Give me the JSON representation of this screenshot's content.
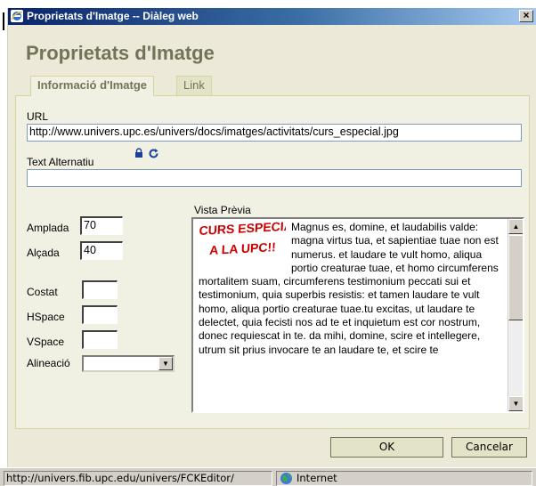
{
  "window": {
    "title": "Proprietats d'Imatge -- Diàleg web",
    "close_glyph": "×"
  },
  "dialog": {
    "heading": "Proprietats d'Imatge"
  },
  "tabs": [
    {
      "label": "Informació d'Imatge",
      "active": true
    },
    {
      "label": "Link",
      "active": false
    }
  ],
  "form": {
    "url_label": "URL",
    "url_value": "http://www.univers.upc.es/univers/docs/imatges/activitats/curs_especial.jpg",
    "alt_label": "Text Alternatiu",
    "alt_value": "",
    "width_label": "Amplada",
    "width_value": "70",
    "height_label": "Alçada",
    "height_value": "40",
    "border_label": "Costat",
    "border_value": "",
    "hspace_label": "HSpace",
    "hspace_value": "",
    "vspace_label": "VSpace",
    "vspace_value": "",
    "align_label": "Alineació",
    "align_value": ""
  },
  "preview": {
    "label": "Vista Prèvia",
    "logo_line1": "CURS ESPECIAL",
    "logo_line2": "A LA UPC!!",
    "text": "Magnus es, domine, et laudabilis valde: magna virtus tua, et sapientiae tuae non est numerus. et laudare te vult homo, aliqua portio creaturae tuae, et homo circumferens mortalitem suam, circumferens testimonium peccati sui et testimonium, quia superbis resistis: et tamen laudare te vult homo, aliqua portio creaturae tuae.tu excitas, ut laudare te delectet, quia fecisti nos ad te et inquietum est cor nostrum, donec requiescat in te. da mihi, domine, scire et intellegere, utrum sit prius invocare te an laudare te, et scire te"
  },
  "buttons": {
    "ok": "OK",
    "cancel": "Cancelar"
  },
  "statusbar": {
    "url": "http://univers.fib.upc.edu/univers/FCKEditor/",
    "zone": "Internet"
  },
  "colors": {
    "titlebar_start": "#0a246a",
    "titlebar_end": "#a6caf0",
    "dialog_bg": "#f1f1e3",
    "heading": "#737357",
    "logo_red": "#cc0000"
  },
  "icons": [
    "ie-icon",
    "close-icon",
    "lock-icon",
    "reset-size-icon",
    "dropdown-arrow-icon",
    "scroll-up-icon",
    "scroll-down-icon",
    "globe-icon"
  ]
}
